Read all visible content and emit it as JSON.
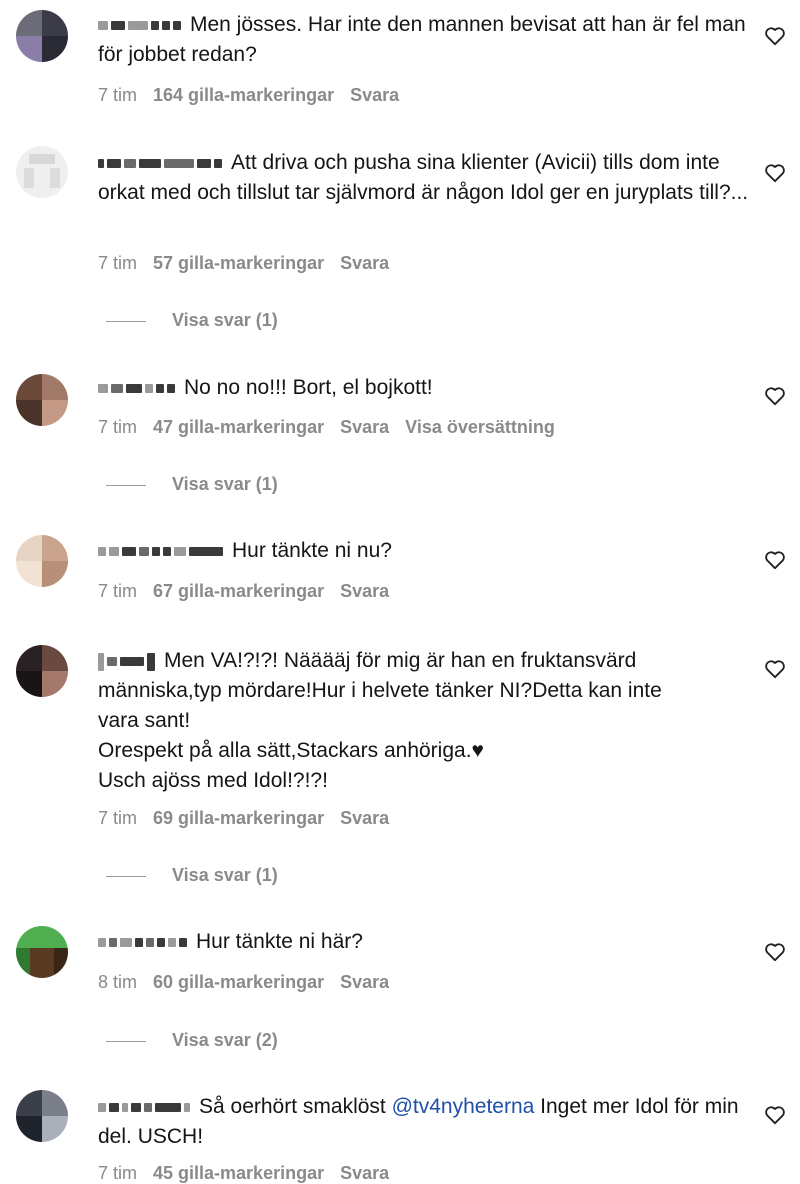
{
  "comments": [
    {
      "text": "Men jösses. Har inte den mannen bevisat att han är fel man för jobbet redan?",
      "time": "7 tim",
      "likes": "164 gilla-markeringar",
      "reply": "Svara",
      "avatar_colors": [
        "#6b6b7a",
        "#3c3c48",
        "#8a7ea8",
        "#2a2a35"
      ]
    },
    {
      "text": "Att driva och pusha sina klienter (Avicii) tills dom inte orkat med och tillslut tar självmord är någon Idol ger en juryplats till?...",
      "time": "7 tim",
      "likes": "57 gilla-markeringar",
      "reply": "Svara",
      "view_replies": "Visa svar (1)",
      "avatar_colors": [
        "#e6e6e6",
        "#d4d4d4",
        "#f0f0f0",
        "#dcdcdc"
      ]
    },
    {
      "text": "No no no!!! Bort, el bojkott!",
      "time": "7 tim",
      "likes": "47 gilla-markeringar",
      "reply": "Svara",
      "translate": "Visa översättning",
      "view_replies": "Visa svar (1)",
      "avatar_colors": [
        "#6b4a3a",
        "#a07a66",
        "#4a3328",
        "#c49a86"
      ]
    },
    {
      "text": "Hur tänkte ni nu?",
      "time": "7 tim",
      "likes": "67 gilla-markeringar",
      "reply": "Svara",
      "avatar_colors": [
        "#e8d4c4",
        "#caa48c",
        "#f2e2d4",
        "#b8907a"
      ]
    },
    {
      "lines": [
        "Men VA!?!?! Nääääj för mig är han en fruktansvärd",
        "människa,typ mördare!Hur i helvete tänker NI?Detta kan inte",
        "vara sant!",
        "Orespekt på alla sätt,Stackars anhöriga.♥",
        "Usch ajöss med Idol!?!?!"
      ],
      "time": "7 tim",
      "likes": "69 gilla-markeringar",
      "reply": "Svara",
      "view_replies": "Visa svar (1)",
      "avatar_colors": [
        "#2a2222",
        "#6a4a40",
        "#1a1414",
        "#a4786a"
      ]
    },
    {
      "text": "Hur tänkte ni här?",
      "time": "8 tim",
      "likes": "60 gilla-markeringar",
      "reply": "Svara",
      "view_replies": "Visa svar (2)",
      "avatar_colors": [
        "#4fae4f",
        "#2f7a2f",
        "#5a3a22",
        "#3a2616"
      ]
    },
    {
      "text_before": "Så oerhört smaklöst ",
      "mention": "@tv4nyheterna",
      "text_after": " Inget mer Idol för min del. USCH!",
      "time": "7 tim",
      "likes": "45 gilla-markeringar",
      "reply": "Svara",
      "avatar_colors": [
        "#3a3f4a",
        "#7a7f8a",
        "#1f232b",
        "#aab0ba"
      ]
    }
  ]
}
